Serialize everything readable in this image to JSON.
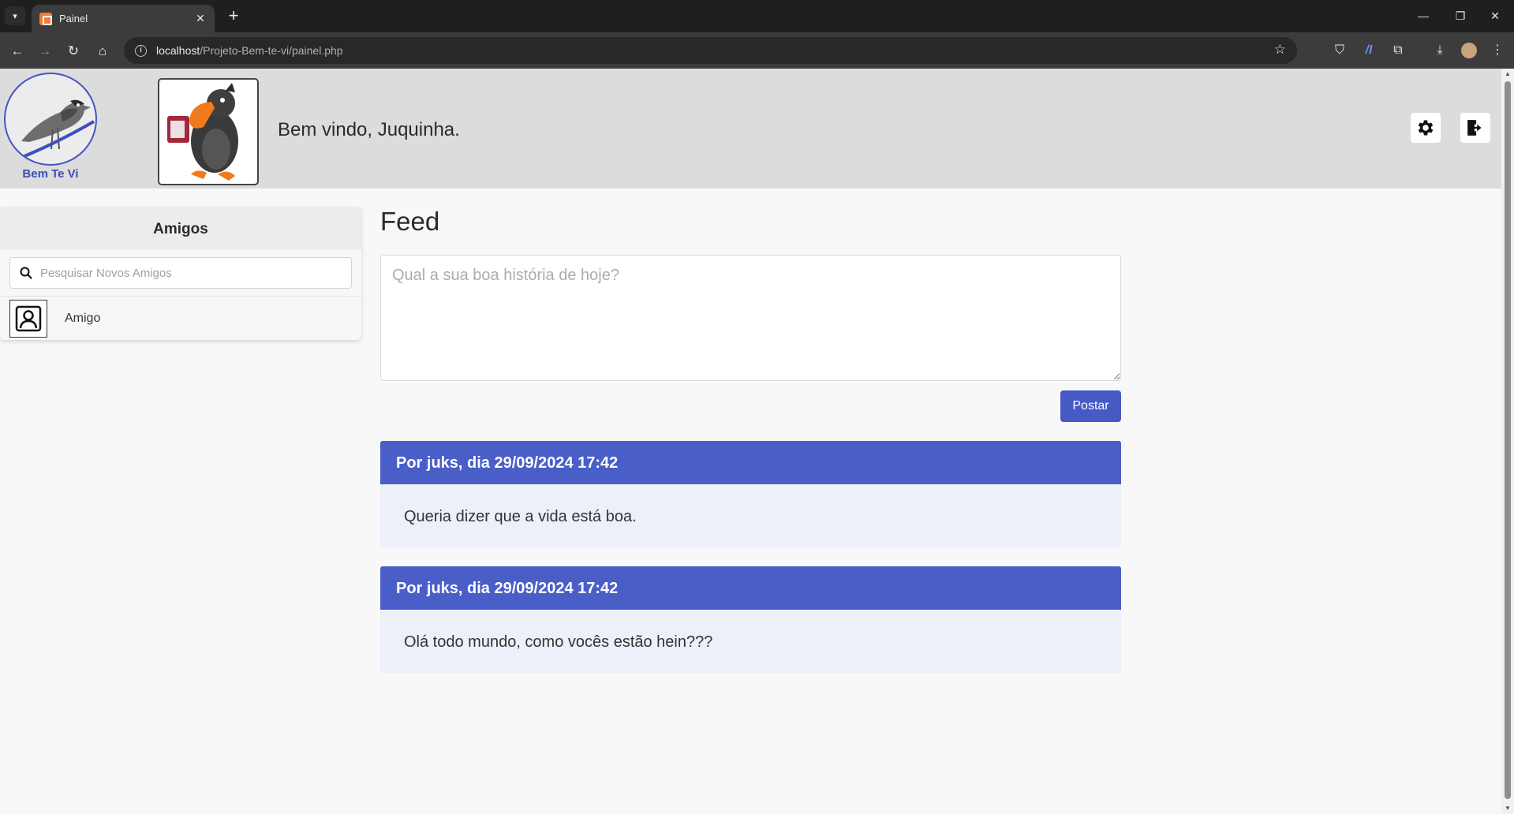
{
  "browser": {
    "tab_title": "Painel",
    "tab_close": "✕",
    "new_tab": "+",
    "url_host": "localhost",
    "url_path": "/Projeto-Bem-te-vi/painel.php",
    "window_controls": {
      "minimize": "—",
      "restore": "❐",
      "close": "✕"
    }
  },
  "header": {
    "logo_text": "Bem Te Vi",
    "welcome": "Bem vindo, Juquinha."
  },
  "sidebar": {
    "title": "Amigos",
    "search_placeholder": "Pesquisar Novos Amigos",
    "friends": [
      {
        "name": "Amigo"
      }
    ]
  },
  "feed": {
    "title": "Feed",
    "composer_placeholder": "Qual a sua boa história de hoje?",
    "post_button": "Postar",
    "posts": [
      {
        "header": "Por juks, dia 29/09/2024 17:42",
        "body": "Queria dizer que a vida está boa."
      },
      {
        "header": "Por juks, dia 29/09/2024 17:42",
        "body": "Olá todo mundo, como vocês estão hein???"
      }
    ]
  },
  "colors": {
    "accent": "#4a5ec7",
    "header_bg": "#dcdcdc",
    "post_body_bg": "#ecf0f8"
  },
  "icons": {
    "settings": "gear-icon",
    "logout": "logout-icon",
    "search": "search-icon",
    "friend": "user-portrait-icon"
  }
}
